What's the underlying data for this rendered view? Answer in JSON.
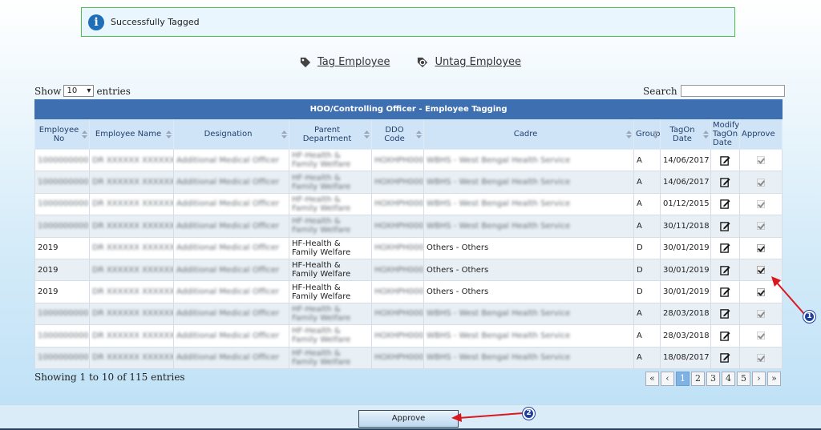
{
  "alert": {
    "text": "Successfully Tagged"
  },
  "links": {
    "tag": "Tag Employee",
    "untag": "Untag Employee"
  },
  "length_menu": {
    "show": "Show",
    "selected": "10",
    "entries": "entries"
  },
  "search": {
    "label": "Search"
  },
  "table": {
    "caption": "HOO/Controlling Officer - Employee Tagging",
    "headers": [
      "Employee No",
      "Employee Name",
      "Designation",
      "Parent Department",
      "DDO Code",
      "Cadre",
      "Group",
      "TagOn Date",
      "Modify TagOn Date",
      "Approve"
    ],
    "rows": [
      {
        "emp_no": "",
        "emp_name": "",
        "designation": "",
        "dept": "",
        "ddo": "",
        "cadre": "",
        "group": "A",
        "date": "14/06/2017",
        "approved": true,
        "enabled": false
      },
      {
        "emp_no": "",
        "emp_name": "",
        "designation": "",
        "dept": "",
        "ddo": "",
        "cadre": "",
        "group": "A",
        "date": "14/06/2017",
        "approved": true,
        "enabled": false
      },
      {
        "emp_no": "",
        "emp_name": "",
        "designation": "",
        "dept": "",
        "ddo": "",
        "cadre": "",
        "group": "A",
        "date": "01/12/2015",
        "approved": true,
        "enabled": false
      },
      {
        "emp_no": "",
        "emp_name": "",
        "designation": "",
        "dept": "",
        "ddo": "",
        "cadre": "",
        "group": "A",
        "date": "30/11/2018",
        "approved": true,
        "enabled": false
      },
      {
        "emp_no": "2019",
        "emp_name": "",
        "designation": "",
        "dept": "HF-Health & Family Welfare",
        "ddo": "",
        "cadre": "Others - Others",
        "group": "D",
        "date": "30/01/2019",
        "approved": true,
        "enabled": true
      },
      {
        "emp_no": "2019",
        "emp_name": "",
        "designation": "",
        "dept": "HF-Health & Family Welfare",
        "ddo": "",
        "cadre": "Others - Others",
        "group": "D",
        "date": "30/01/2019",
        "approved": true,
        "enabled": true
      },
      {
        "emp_no": "2019",
        "emp_name": "",
        "designation": "",
        "dept": "HF-Health & Family Welfare",
        "ddo": "",
        "cadre": "Others - Others",
        "group": "D",
        "date": "30/01/2019",
        "approved": true,
        "enabled": true
      },
      {
        "emp_no": "",
        "emp_name": "",
        "designation": "",
        "dept": "",
        "ddo": "",
        "cadre": "",
        "group": "A",
        "date": "28/03/2018",
        "approved": true,
        "enabled": false
      },
      {
        "emp_no": "",
        "emp_name": "",
        "designation": "",
        "dept": "",
        "ddo": "",
        "cadre": "",
        "group": "A",
        "date": "28/03/2018",
        "approved": true,
        "enabled": false
      },
      {
        "emp_no": "",
        "emp_name": "",
        "designation": "",
        "dept": "",
        "ddo": "",
        "cadre": "",
        "group": "A",
        "date": "18/08/2017",
        "approved": true,
        "enabled": false
      }
    ]
  },
  "info": "Showing 1 to 10 of 115 entries",
  "pagination": [
    "«",
    "‹",
    "1",
    "2",
    "3",
    "4",
    "5",
    "›",
    "»"
  ],
  "pagination_active": "1",
  "approve_button": "Approve",
  "markers": [
    "1",
    "2"
  ],
  "colors": {
    "header": "#3e6fb0",
    "alert_border": "#4fbf4f",
    "annotation": "#d9191f"
  }
}
